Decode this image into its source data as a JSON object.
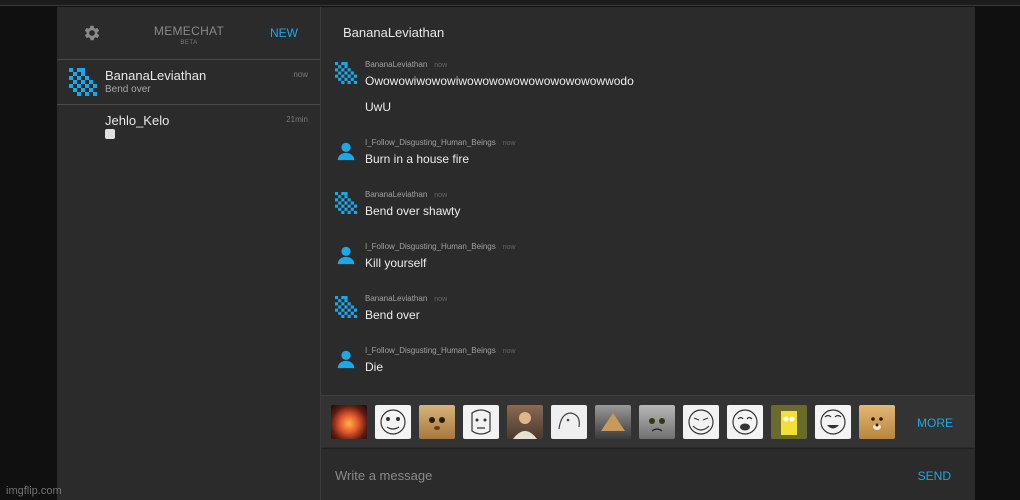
{
  "app": {
    "name": "MEMECHAT",
    "subtitle": "BETA",
    "new_label": "NEW",
    "accent": "#1ba8e6",
    "settings_icon": "gear-icon"
  },
  "conversations": [
    {
      "name": "BananaLeviathan",
      "preview": "Bend over",
      "time": "now",
      "avatar": "pixel-logo-icon"
    },
    {
      "name": "Jehlo_Kelo",
      "preview": "",
      "time": "21min",
      "avatar": "none",
      "preview_icon": "meme-emoji-icon"
    }
  ],
  "chat": {
    "title": "BananaLeviathan",
    "messages": [
      {
        "author": "BananaLeviathan",
        "time": "now",
        "avatar": "pixel-logo-icon",
        "lines": [
          "Owowowiwowowiwowowowowowowowowowwodo",
          "UwU"
        ]
      },
      {
        "author": "I_Follow_Disgusting_Human_Beings",
        "time": "now",
        "avatar": "user-icon",
        "lines": [
          "Burn in a house fire"
        ]
      },
      {
        "author": "BananaLeviathan",
        "time": "now",
        "avatar": "pixel-logo-icon",
        "lines": [
          "Bend over shawty"
        ]
      },
      {
        "author": "I_Follow_Disgusting_Human_Beings",
        "time": "now",
        "avatar": "user-icon",
        "lines": [
          "Kill yourself"
        ]
      },
      {
        "author": "BananaLeviathan",
        "time": "now",
        "avatar": "pixel-logo-icon",
        "lines": [
          "Bend over"
        ]
      },
      {
        "author": "I_Follow_Disgusting_Human_Beings",
        "time": "now",
        "avatar": "user-icon",
        "lines": [
          "Die"
        ]
      }
    ]
  },
  "emoji_bar": {
    "items": [
      "explosion",
      "rage-face-1",
      "cat",
      "rage-face-2",
      "jesus",
      "meme-face",
      "illuminati",
      "grumpy-cat",
      "rage-face-3",
      "rage-face-4",
      "spongebob",
      "laughing-face",
      "doge"
    ],
    "more_label": "MORE"
  },
  "composer": {
    "placeholder": "Write a message",
    "send_label": "SEND"
  },
  "watermark": "imgflip.com"
}
